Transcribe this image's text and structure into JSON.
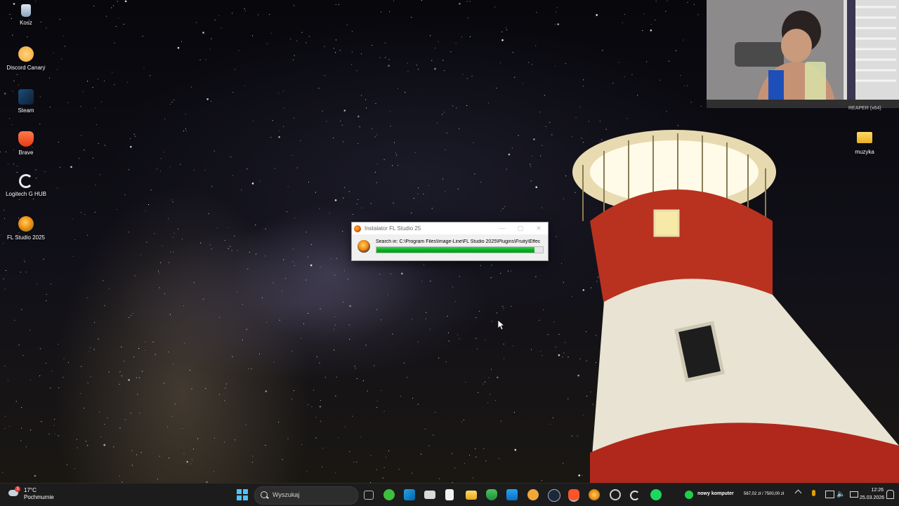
{
  "desktop": {
    "icons": [
      {
        "label": "Kosz",
        "icon": "recycle-bin-icon",
        "color": "#9fb7d6"
      },
      {
        "label": "Discord Canary",
        "icon": "discord-canary-icon",
        "color": "#f2a73a"
      },
      {
        "label": "Steam",
        "icon": "steam-icon",
        "color": "#1b2838"
      },
      {
        "label": "Brave",
        "icon": "brave-icon",
        "color": "#fb542b"
      },
      {
        "label": "Logitech G HUB",
        "icon": "logitech-ghub-icon",
        "color": "#e8e8e8"
      },
      {
        "label": "FL Studio 2025",
        "icon": "fl-studio-icon",
        "color": "#f08a14"
      }
    ],
    "right_icons": [
      {
        "label": "muzyka",
        "icon": "folder-icon",
        "color": "#f5c542"
      }
    ],
    "webcam_label": "REAPER (x64)"
  },
  "installer": {
    "title": "Instalator FL Studio 25",
    "status_text": "Search in: C:\\Program Files\\Image-Line\\FL Studio 2025\\Plugins\\Fruity\\Effec",
    "progress_percent": 95,
    "controls": {
      "minimize": "—",
      "maximize": "▢",
      "close": "✕"
    }
  },
  "taskbar": {
    "weather": {
      "temp": "17°C",
      "condition": "Pochmurnie",
      "badge": "3"
    },
    "search_placeholder": "Wyszukaj",
    "apps": [
      "start",
      "search",
      "task-view",
      "xbox",
      "vscode",
      "mail",
      "notepad",
      "file-explorer",
      "brave-beta",
      "store",
      "discord-canary",
      "steam",
      "brave",
      "fl-studio",
      "chrome-like",
      "logitech",
      "spotify"
    ],
    "tray": {
      "goal_label": "nowy komputer",
      "goal_progress": "567,02 zł / 7500,00 zł",
      "time": "12:26",
      "date": "25.03.2026"
    }
  },
  "colors": {
    "accent": "#06b025",
    "taskbar_bg": "#1c1c1c",
    "lighthouse_red": "#b8321f"
  }
}
